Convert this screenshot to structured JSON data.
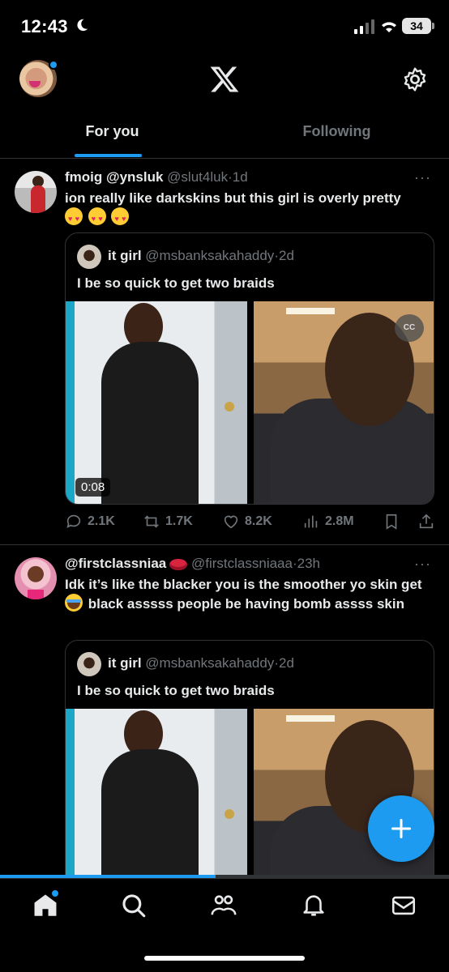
{
  "status_bar": {
    "time": "12:43",
    "battery": "34"
  },
  "header": {
    "logo": "x-logo-icon"
  },
  "tabs": [
    {
      "label": "For you",
      "active": true
    },
    {
      "label": "Following",
      "active": false
    }
  ],
  "tweets": [
    {
      "name": "fmoig @ynsluk",
      "handle": "@slut4luk",
      "time": "1d",
      "text": "ion really like darkskins but this girl is overly pretty",
      "emojis": [
        "heart-eyes",
        "heart-eyes",
        "heart-eyes"
      ],
      "quote": {
        "name": "it girl",
        "handle": "@msbanksakahaddy",
        "time": "2d",
        "text": "I be so quick to get two braids",
        "video_duration": "0:08"
      },
      "actions": {
        "replies": "2.1K",
        "reposts": "1.7K",
        "likes": "8.2K",
        "views": "2.8M"
      }
    },
    {
      "name": "@firstclassniaa",
      "handle": "@firstclassniaaa",
      "time": "23h",
      "text_part1": "Idk it’s like the blacker you is the smoother yo skin get",
      "text_part2": "black asssss people be having bomb assss skin",
      "quote": {
        "name": "it girl",
        "handle": "@msbanksakahaddy",
        "time": "2d",
        "text": "I be so quick to get two braids"
      }
    }
  ],
  "separator": "·",
  "more": "···",
  "colors": {
    "accent": "#1d9bf0",
    "background": "#000000",
    "secondary_text": "#71767b"
  },
  "bottom_nav": [
    "home-icon",
    "search-icon",
    "communities-icon",
    "notifications-icon",
    "messages-icon"
  ],
  "media_progress": 0.48
}
